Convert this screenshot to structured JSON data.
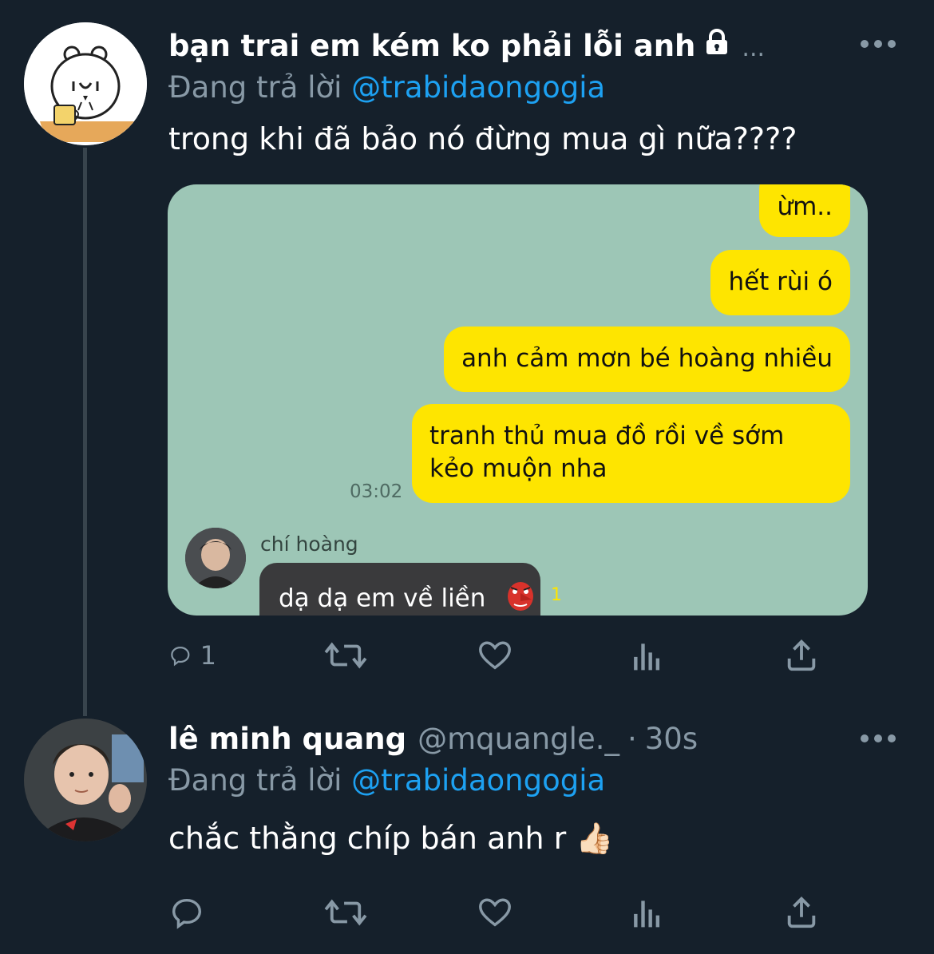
{
  "tweet1": {
    "display_name": "bạn trai em kém ko phải lỗi anh",
    "handle_truncated": "...",
    "reply_prefix": "Đang trả lời",
    "reply_mention": "@trabidaongogia",
    "text": "trong khi đã bảo nó đừng mua gì nữa????",
    "lock_icon": "lock-icon",
    "chat": {
      "messages_sent": [
        "ừm..",
        "hết rùi ó",
        "anh cảm mơn bé hoàng nhiều",
        "tranh thủ mua đồ rồi về sớm kẻo muộn nha"
      ],
      "sent_time": "03:02",
      "friend_name": "chí hoàng",
      "friend_message": "dạ dạ em về liền",
      "unread_count": "1"
    },
    "reply_count": "1"
  },
  "tweet2": {
    "display_name": "lê minh quang",
    "handle": "@mquangle._",
    "dot": "·",
    "time": "30s",
    "reply_prefix": "Đang trả lời",
    "reply_mention": "@trabidaongogia",
    "text": "chắc thằng chíp bán anh r 👍🏻"
  },
  "colors": {
    "background": "#15202b",
    "secondary_text": "#8899a6",
    "link": "#1da1f2",
    "chat_background": "#9dc6b6",
    "chat_bubble": "#fee500"
  }
}
